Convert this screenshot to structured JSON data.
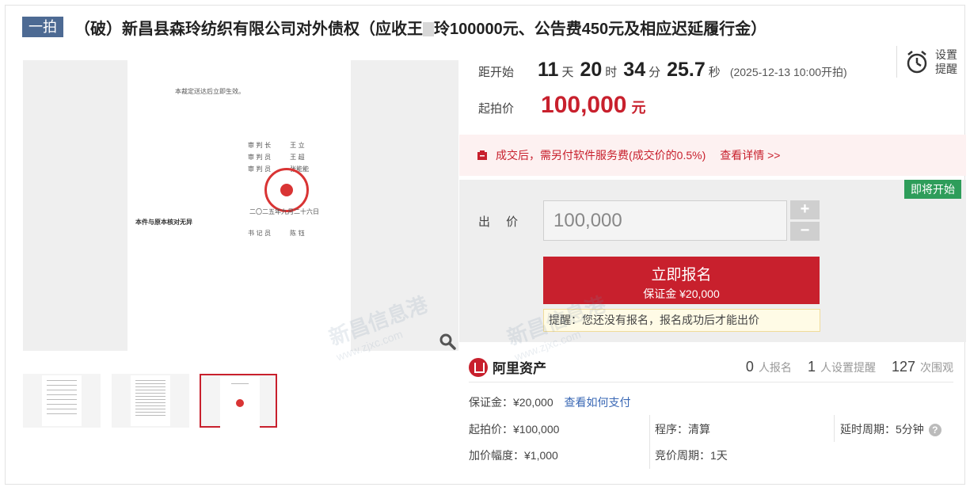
{
  "header": {
    "round_badge": "一拍",
    "title": "（破）新昌县森玲纺织有限公司对外债权（应收王",
    "title_suffix": "玲100000元、公告费450元及相应迟延履行金）"
  },
  "document": {
    "top_note": "本裁定送达后立即生效。",
    "signatures": [
      "审 判 长　　　王 立",
      "审 判 员　　　王 超",
      "审 判 员　　　张能能"
    ],
    "date": "二〇二五年九月二十六日",
    "copy_note": "本件与原本核对无异",
    "clerk": "书 记 员　　　陈 钰"
  },
  "countdown": {
    "label": "距开始",
    "days": "11",
    "days_unit": "天",
    "hours": "20",
    "hours_unit": "时",
    "minutes": "34",
    "minutes_unit": "分",
    "seconds": "25.7",
    "seconds_unit": "秒",
    "start_time": "(2025-12-13 10:00开拍)"
  },
  "reminder": {
    "line1": "设置",
    "line2": "提醒"
  },
  "start_price": {
    "label": "起拍价",
    "value": "100,000",
    "unit": "元"
  },
  "fee_notice": {
    "text": "成交后，需另付软件服务费(成交价的0.5%)",
    "link": "查看详情 >>"
  },
  "bid": {
    "status_badge": "即将开始",
    "label": "出 价",
    "input_value": "100,000",
    "plus": "+",
    "minus": "−",
    "apply_label": "立即报名",
    "deposit_label": "保证金 ¥20,000",
    "tip": "提醒：您还没有报名，报名成功后才能出价"
  },
  "brand": {
    "name": "阿里资产"
  },
  "stats": [
    {
      "value": "0",
      "label": "人报名"
    },
    {
      "value": "1",
      "label": "人设置提醒"
    },
    {
      "value": "127",
      "label": "次围观"
    }
  ],
  "details": {
    "deposit": "保证金：¥20,000",
    "pay_link": "查看如何支付",
    "start_price": "起拍价：¥100,000",
    "increment": "加价幅度：¥1,000",
    "procedure": "程序：清算",
    "bidding_period": "竞价周期：1天",
    "delay_period": "延时周期：5分钟",
    "help": "?"
  },
  "watermark": {
    "brand": "新昌信息港",
    "url": "www.zjxc.com"
  },
  "colors": {
    "accent": "#c8202d",
    "badge_blue": "#4d6a93",
    "status_green": "#2e9d5a",
    "link_blue": "#3a68b5"
  }
}
